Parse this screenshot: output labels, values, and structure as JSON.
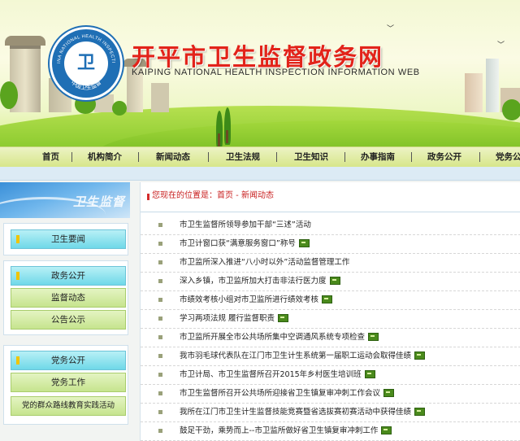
{
  "header": {
    "title": "开平市卫生监督政务网",
    "subtitle": "KAIPING NATIONAL HEALTH INSPECTION INFORMATION WEB",
    "logo_glyph": "卫",
    "logo_ring_text_top": "CHINA NATIONAL HEALTH INSPECTION",
    "logo_ring_text_bottom": "中国卫生监督"
  },
  "nav": {
    "items": [
      "首页",
      "机构简介",
      "新闻动态",
      "卫生法规",
      "卫生知识",
      "办事指南",
      "政务公开",
      "党务公开"
    ]
  },
  "sidebar": {
    "header_label": "卫生监督",
    "groups": [
      {
        "items": [
          {
            "label": "卫生要闻",
            "style": "cyan"
          }
        ]
      },
      {
        "items": [
          {
            "label": "政务公开",
            "style": "cyan"
          },
          {
            "label": "监督动态",
            "style": "green"
          },
          {
            "label": "公告公示",
            "style": "green"
          }
        ]
      },
      {
        "items": [
          {
            "label": "党务公开",
            "style": "cyan"
          },
          {
            "label": "党务工作",
            "style": "green"
          },
          {
            "label": "党的群众路线教育实践活动",
            "style": "green"
          }
        ]
      }
    ]
  },
  "breadcrumb": {
    "prefix": "您现在的位置是：",
    "home": "首页",
    "separator": " - ",
    "current": "新闻动态"
  },
  "news": [
    {
      "title": "市卫生监督所领导参加干部“三述”活动",
      "new": false
    },
    {
      "title": "市卫计窗口获“满意服务窗口”称号",
      "new": true
    },
    {
      "title": "市卫监所深入推进“八小时以外”活动监督管理工作",
      "new": false
    },
    {
      "title": "深入乡镇，市卫监所加大打击非法行医力度",
      "new": true
    },
    {
      "title": "市绩效考核小组对市卫监所进行绩效考核",
      "new": true
    },
    {
      "title": "学习两项法规 履行监督职责",
      "new": true
    },
    {
      "title": "市卫监所开展全市公共场所集中空调通风系统专项检查",
      "new": true
    },
    {
      "title": "我市羽毛球代表队在江门市卫生计生系统第一届职工运动会取得佳绩",
      "new": true
    },
    {
      "title": "市卫计局、市卫生监督所召开2015年乡村医生培训班",
      "new": true
    },
    {
      "title": "市卫生监督所召开公共场所迎接省卫生镇复审冲刺工作会议",
      "new": true
    },
    {
      "title": "我所在江门市卫生计生监督技能竞赛暨省选拔赛初赛活动中获得佳绩",
      "new": true
    },
    {
      "title": "鼓足干劲，乘势而上--市卫监所做好省卫生镇复审冲刺工作",
      "new": true
    }
  ],
  "colors": {
    "title_red": "#e2231a",
    "breadcrumb_red": "#c81e1e",
    "nav_bg": "#d7e68a",
    "sidebar_cyan": "#6fd8e8",
    "sidebar_green": "#c6e48e"
  }
}
